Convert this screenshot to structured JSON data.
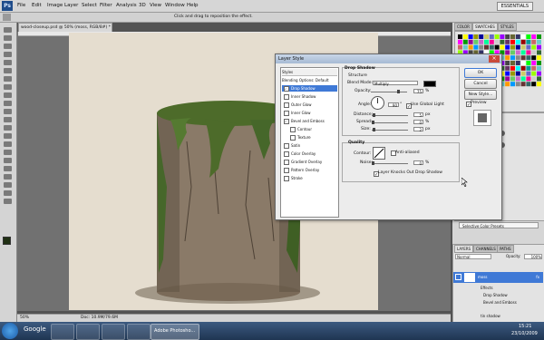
{
  "menu": {
    "logo": "Ps",
    "items": [
      "File",
      "Edit",
      "Image",
      "Layer",
      "Select",
      "Filter",
      "Analysis",
      "3D",
      "View",
      "Window",
      "Help"
    ],
    "workspace": "ESSENTIALS"
  },
  "options": {
    "hint": "Click and drag to reposition the effect."
  },
  "document": {
    "tab": "wood-closeup.psd @ 50% (moss, RGB/8#) *",
    "zoom": "50%",
    "doc_size": "Doc: 10.9M/79.6M"
  },
  "panels": {
    "top_tabs": [
      "COLOR",
      "SWATCHES",
      "STYLES"
    ],
    "layer_tabs": [
      "LAYERS",
      "CHANNELS",
      "PATHS"
    ],
    "blend": "Normal",
    "opacity_label": "Opacity:",
    "opacity": "100%",
    "layers": [
      {
        "name": "moss",
        "fx": "fx"
      },
      {
        "name": "Effects"
      },
      {
        "name": "Drop Shadow"
      },
      {
        "name": "Bevel and Emboss"
      },
      {
        "name": "tin shadow"
      }
    ],
    "adjust": "Selective Color Presets"
  },
  "dialog": {
    "title": "Layer Style",
    "styles_header": "Styles",
    "blending": "Blending Options: Default",
    "items": [
      {
        "label": "Drop Shadow",
        "checked": true,
        "selected": true
      },
      {
        "label": "Inner Shadow",
        "checked": false
      },
      {
        "label": "Outer Glow",
        "checked": false
      },
      {
        "label": "Inner Glow",
        "checked": false
      },
      {
        "label": "Bevel and Emboss",
        "checked": true
      },
      {
        "label": "Contour",
        "checked": false
      },
      {
        "label": "Texture",
        "checked": false
      },
      {
        "label": "Satin",
        "checked": false
      },
      {
        "label": "Color Overlay",
        "checked": false
      },
      {
        "label": "Gradient Overlay",
        "checked": false
      },
      {
        "label": "Pattern Overlay",
        "checked": false
      },
      {
        "label": "Stroke",
        "checked": false
      }
    ],
    "section_title": "Drop Shadow",
    "structure": "Structure",
    "blend_mode_label": "Blend Mode:",
    "blend_mode": "Multiply",
    "opacity_label": "Opacity:",
    "opacity": "75",
    "angle_label": "Angle:",
    "angle": "90",
    "use_global": "Use Global Light",
    "distance_label": "Distance:",
    "distance": "5",
    "spread_label": "Spread:",
    "spread": "0",
    "size_label": "Size:",
    "size": "2",
    "px": "px",
    "pct": "%",
    "deg": "°",
    "quality": "Quality",
    "contour_label": "Contour:",
    "anti_aliased": "Anti-aliased",
    "noise_label": "Noise:",
    "noise": "0",
    "knockout": "Layer Knocks Out Drop Shadow",
    "ok": "OK",
    "cancel": "Cancel",
    "new_style": "New Style...",
    "preview": "Preview"
  },
  "taskbar": {
    "apps": [
      "Google"
    ],
    "active": "Adobe Photosho...",
    "time": "15:21",
    "date": "23/10/2009"
  },
  "colors": {
    "accent": "#3f79d6",
    "moss": "#4d6b2a",
    "bark": "#8a7a68",
    "canvas": "#e5ddcf"
  }
}
